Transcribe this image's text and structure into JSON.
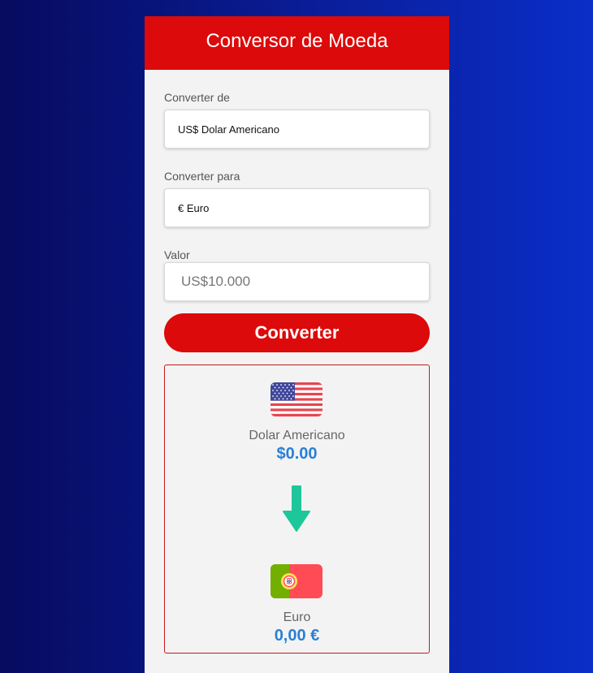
{
  "header": {
    "title": "Conversor de Moeda"
  },
  "form": {
    "from_label": "Converter de",
    "from_selected": "US$ Dolar Americano",
    "to_label": "Converter para",
    "to_selected": "€ Euro",
    "value_label": "Valor",
    "value_placeholder": "US$10.000",
    "convert_label": "Converter"
  },
  "result": {
    "from_flag": "usa-flag-icon",
    "from_currency": "Dolar Americano",
    "from_amount": "$0.00",
    "arrow_icon": "arrow-down-icon",
    "to_flag": "portugal-flag-icon",
    "to_currency": "Euro",
    "to_amount": "0,00 €"
  },
  "colors": {
    "accent_red": "#dc0a0a",
    "amount_blue": "#2a7fd6",
    "arrow_green": "#1ec79a",
    "panel_bg": "#f3f3f3"
  }
}
